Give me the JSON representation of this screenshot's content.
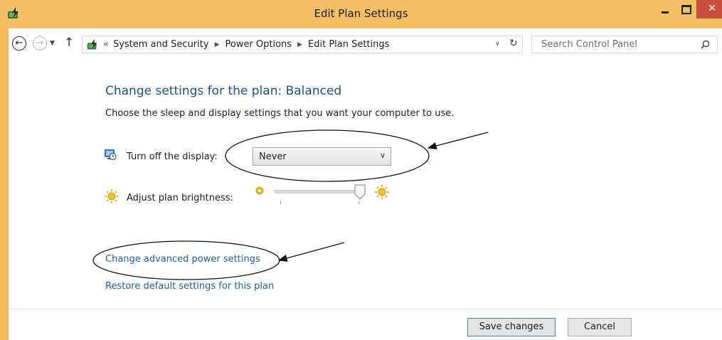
{
  "window": {
    "title": "Edit Plan Settings",
    "close_glyph": "✕"
  },
  "nav": {
    "back_glyph": "←",
    "forward_glyph": "→",
    "history_glyph": "▼",
    "up_glyph": "↑",
    "breadcrumb_lead": "«",
    "breadcrumbs": [
      "System and Security",
      "Power Options",
      "Edit Plan Settings"
    ],
    "breadcrumb_sep": "▶",
    "address_dd_glyph": "∨",
    "refresh_glyph": "↻",
    "search_placeholder": "Search Control Panel"
  },
  "content": {
    "heading": "Change settings for the plan: Balanced",
    "subheading": "Choose the sleep and display settings that you want your computer to use.",
    "display_label": "Turn off the display:",
    "display_value": "Never",
    "display_chevron": "∨",
    "brightness_label": "Adjust plan brightness:",
    "brightness_level": 1.0,
    "link_advanced": "Change advanced power settings",
    "link_restore": "Restore default settings for this plan"
  },
  "footer": {
    "save_label": "Save changes",
    "cancel_label": "Cancel"
  },
  "icons": {
    "app": "power-options-icon",
    "address": "power-options-icon",
    "display": "monitor-clock-icon",
    "brightness": "sun-icon",
    "dim": "dim-sun-icon",
    "bright": "bright-sun-icon",
    "search": "search-icon"
  },
  "colors": {
    "titlebar": "#f4bf63",
    "close": "#c9503f",
    "link": "#1f5ea8",
    "heading": "#1e4e8c"
  }
}
